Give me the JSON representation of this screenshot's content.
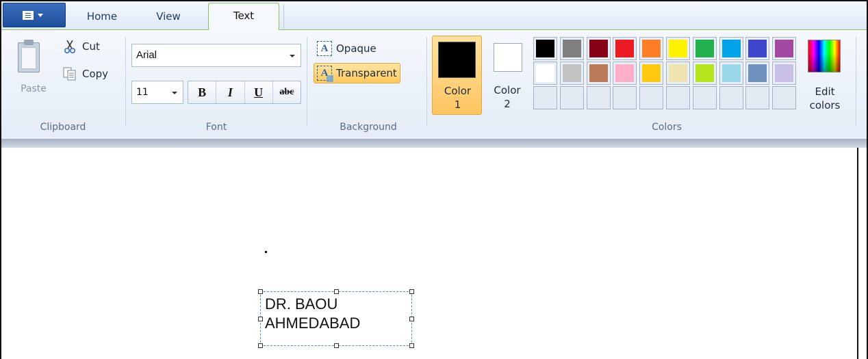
{
  "tabs": {
    "home": "Home",
    "view": "View",
    "text": "Text"
  },
  "clipboard": {
    "group_label": "Clipboard",
    "paste": "Paste",
    "cut": "Cut",
    "copy": "Copy"
  },
  "font": {
    "group_label": "Font",
    "family": "Arial",
    "size": "11",
    "bold": "B",
    "italic": "I",
    "underline": "U",
    "strikethrough": "abc"
  },
  "background": {
    "group_label": "Background",
    "opaque": "Opaque",
    "transparent": "Transparent",
    "icon_letter": "A",
    "selected": "transparent"
  },
  "colors": {
    "group_label": "Colors",
    "color1_label": "Color 1",
    "color2_label": "Color 2",
    "edit_label": "Edit colors",
    "color1": "#000000",
    "color2": "#ffffff",
    "palette": [
      "#000000",
      "#7f7f7f",
      "#880015",
      "#ed1c24",
      "#ff7f27",
      "#fff200",
      "#22b14c",
      "#00a2e8",
      "#3f48cc",
      "#a349a4",
      "#ffffff",
      "#c3c3c3",
      "#b97a57",
      "#ffaec9",
      "#ffc90e",
      "#efe4b0",
      "#b5e61d",
      "#99d9ea",
      "#7092be",
      "#c8bfe7",
      "",
      "",
      "",
      "",
      "",
      "",
      "",
      "",
      "",
      ""
    ]
  },
  "canvas": {
    "text_lines": "DR. BAOU\nAHMEDABAD"
  }
}
